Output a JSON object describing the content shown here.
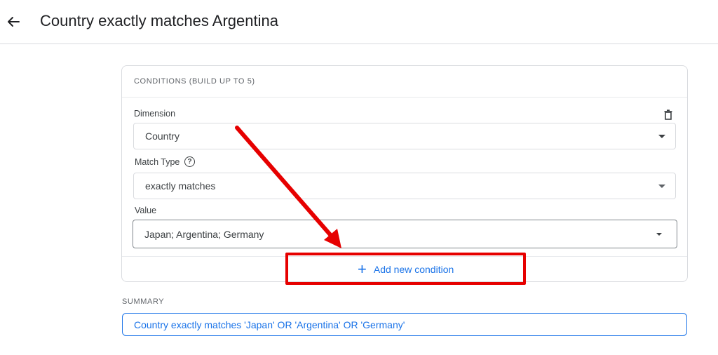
{
  "header": {
    "title": "Country exactly matches Argentina",
    "back_icon": "back-arrow-icon"
  },
  "conditions": {
    "heading": "CONDITIONS (BUILD UP TO 5)",
    "delete_icon": "trash-icon",
    "dimension": {
      "label": "Dimension",
      "value": "Country"
    },
    "match_type": {
      "label": "Match Type",
      "value": "exactly matches",
      "help_icon": "help-circle-icon"
    },
    "value": {
      "label": "Value",
      "value": "Japan; Argentina; Germany"
    },
    "add_button": {
      "icon": "plus-icon",
      "label": "Add new condition"
    }
  },
  "summary": {
    "label": "SUMMARY",
    "text": "Country exactly matches 'Japan' OR 'Argentina' OR 'Germany'"
  },
  "colors": {
    "accent": "#1a73e8",
    "annotation": "#e60000",
    "border": "#dadce0"
  }
}
